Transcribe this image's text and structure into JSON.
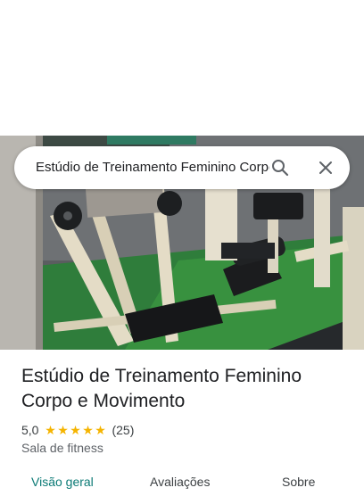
{
  "search": {
    "query": "Estúdio de Treinamento Feminino Corpo e Movimento",
    "search_icon": "search-icon",
    "close_icon": "close-icon"
  },
  "place": {
    "name": "Estúdio de Treinamento Feminino Corpo e Movimento",
    "rating": "5,0",
    "stars": 5,
    "review_count": "(25)",
    "category": "Sala de fitness"
  },
  "tabs": [
    {
      "label": "Visão geral",
      "active": true
    },
    {
      "label": "Avaliações",
      "active": false
    },
    {
      "label": "Sobre",
      "active": false
    }
  ],
  "colors": {
    "accent": "#0b7a75",
    "star": "#f5b400",
    "text": "#202124",
    "secondary": "#5f6368"
  }
}
